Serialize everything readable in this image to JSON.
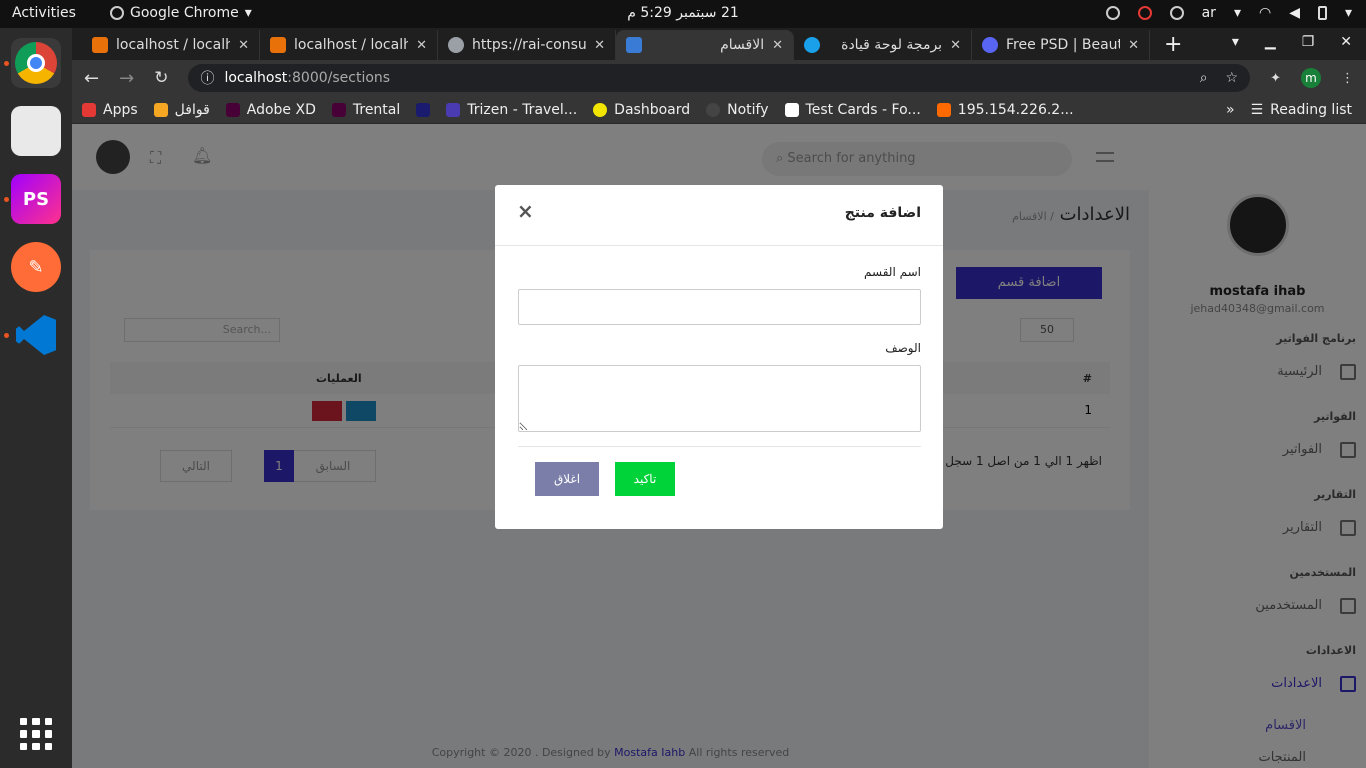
{
  "os": {
    "activities": "Activities",
    "app_name": "Google Chrome",
    "clock": "21 سبتمبر  5:29 م",
    "lang": "ar"
  },
  "browser": {
    "tabs": [
      {
        "label": "localhost / localh",
        "color": "#e8710a"
      },
      {
        "label": "localhost / localh",
        "color": "#e8710a"
      },
      {
        "label": "https://rai-consu",
        "color": "#9aa0a6"
      },
      {
        "label": "الاقسام",
        "color": "#3a7bd5"
      },
      {
        "label": "برمجة لوحة قيادة",
        "color": "#1aa0e8"
      },
      {
        "label": "Free PSD | Beaut",
        "color": "#5865f2"
      }
    ],
    "url_host": "localhost",
    "url_path": ":8000/sections",
    "profile_letter": "m",
    "bookmarks": [
      {
        "label": "Apps",
        "color": "#e53935"
      },
      {
        "label": "قوافل",
        "color": "#f5a623"
      },
      {
        "label": "Adobe XD",
        "color": "#470137"
      },
      {
        "label": "Trental",
        "color": "#470137"
      },
      {
        "label": "",
        "color": "#1a1a6e"
      },
      {
        "label": "Trizen - Travel...",
        "color": "#4b3bb3"
      },
      {
        "label": "Dashboard",
        "color": "#f2e600"
      },
      {
        "label": "Notify",
        "color": "#444444"
      },
      {
        "label": "Test Cards - Fo...",
        "color": "#ffffff"
      },
      {
        "label": "195.154.226.2...",
        "color": "#ff6a00"
      }
    ],
    "more": "»",
    "reading_list": "Reading list"
  },
  "page": {
    "search_placeholder": "Search for anything",
    "breadcrumb_title": "الاعدادات",
    "breadcrumb_sub": "/ الاقسام",
    "add_section": "اضافة قسم",
    "page_size": "50",
    "table_search": "Search...",
    "col_num": "#",
    "col_ops": "العمليات",
    "row_num": "1",
    "info": "اظهر 1 الي 1 من اصل 1 سجل",
    "pager": {
      "prev": "السابق",
      "current": "1",
      "next": "التالي"
    },
    "footer_pre": "Copyright © 2020 . Designed by",
    "footer_link": "Mostafa Iahb",
    "footer_post": "All rights reserved",
    "sidebar": {
      "user_name": "mostafa ihab",
      "user_email": "jehad40348@gmail.com",
      "group_app": "برنامج الفواتير",
      "home": "الرئيسية",
      "group_invoices": "الفواتير",
      "invoices": "الفواتير",
      "group_reports": "التقارير",
      "reports": "التقارير",
      "group_users": "المستخدمين",
      "users": "المستخدمين",
      "group_settings": "الاعدادات",
      "settings": "الاعدادات",
      "sections": "الاقسام",
      "products": "المنتجات"
    }
  },
  "modal": {
    "title": "اضافة منتج",
    "close_icon": "×",
    "name_label": "اسم القسم",
    "name_value": "",
    "desc_label": "الوصف",
    "desc_value": "",
    "confirm": "تاكيد",
    "close": "اغلاق"
  }
}
